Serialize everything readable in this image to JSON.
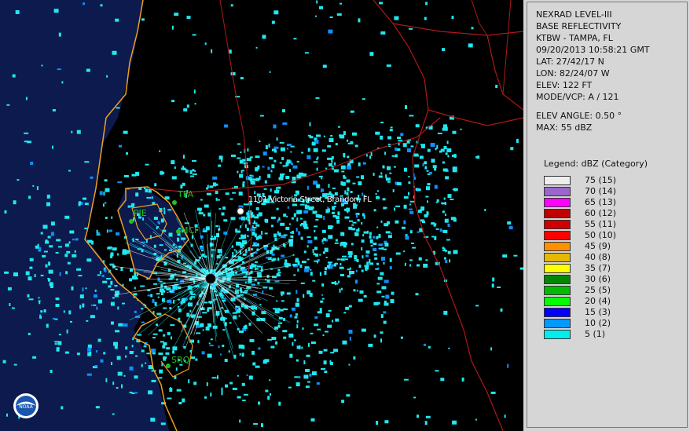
{
  "map": {
    "places": [
      {
        "label": "TPA"
      },
      {
        "label": "PIE"
      },
      {
        "label": "MCF"
      },
      {
        "label": "SRQ"
      }
    ],
    "address": "1101 Victoria Street, Brandon, FL",
    "colors": {
      "land": "#000000",
      "water": "#0c1a4d",
      "coast": "#f0a020",
      "roads": "#b01818",
      "echo": "#20e8f0"
    }
  },
  "info": {
    "lines": [
      "NEXRAD LEVEL-III",
      "BASE REFLECTIVITY",
      "KTBW - TAMPA, FL",
      "09/20/2013 10:58:21 GMT",
      "LAT: 27/42/17 N",
      "LON: 82/24/07 W",
      "ELEV: 122 FT",
      "MODE/VCP: A / 121"
    ],
    "elev_angle": "ELEV ANGLE: 0.50 °",
    "max": "MAX: 55 dBZ"
  },
  "legend": {
    "title": "Legend: dBZ (Category)",
    "items": [
      {
        "label": "75  (15)",
        "color": "#eeeeee"
      },
      {
        "label": "70  (14)",
        "color": "#9966cc"
      },
      {
        "label": "65  (13)",
        "color": "#ff00ff"
      },
      {
        "label": "60  (12)",
        "color": "#c00000"
      },
      {
        "label": "55  (11)",
        "color": "#d00000"
      },
      {
        "label": "50  (10)",
        "color": "#ff0000"
      },
      {
        "label": "45  (9)",
        "color": "#ff9000"
      },
      {
        "label": "40  (8)",
        "color": "#e6b800"
      },
      {
        "label": "35  (7)",
        "color": "#ffff00"
      },
      {
        "label": "30  (6)",
        "color": "#008800"
      },
      {
        "label": "25  (5)",
        "color": "#00bb00"
      },
      {
        "label": "20  (4)",
        "color": "#00ff00"
      },
      {
        "label": "15  (3)",
        "color": "#0000ff"
      },
      {
        "label": "10  (2)",
        "color": "#0099ff"
      },
      {
        "label": "5  (1)",
        "color": "#00eeee"
      }
    ]
  },
  "logo": {
    "text": "NOAA"
  }
}
